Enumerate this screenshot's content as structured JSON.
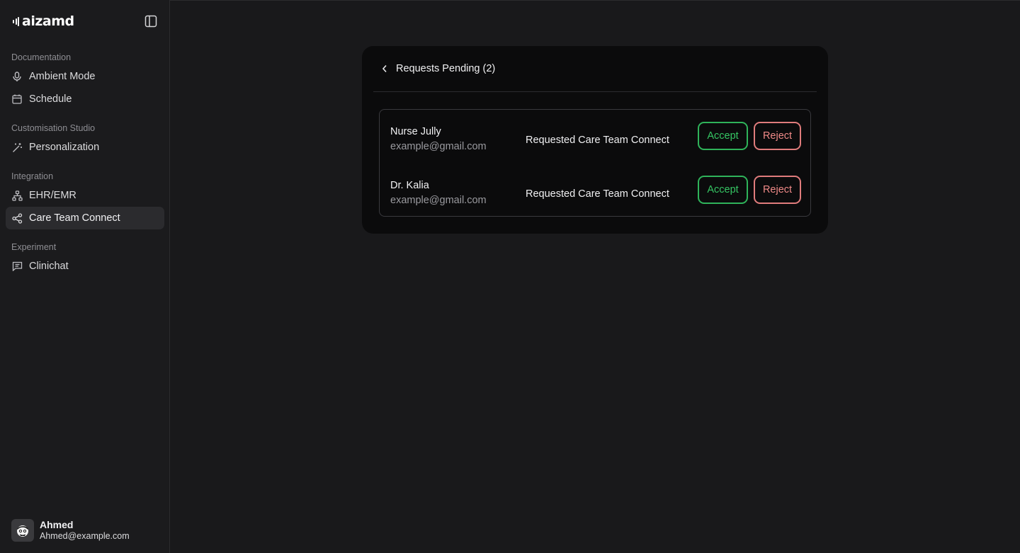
{
  "brand": {
    "name": "aizamd"
  },
  "sidebar": {
    "groups": [
      {
        "label": "Documentation",
        "items": [
          {
            "label": "Ambient Mode",
            "icon": "microphone-icon"
          },
          {
            "label": "Schedule",
            "icon": "calendar-icon"
          }
        ]
      },
      {
        "label": "Customisation Studio",
        "items": [
          {
            "label": "Personalization",
            "icon": "magic-wand-icon"
          }
        ]
      },
      {
        "label": "Integration",
        "items": [
          {
            "label": "EHR/EMR",
            "icon": "network-icon"
          },
          {
            "label": "Care Team Connect",
            "icon": "share-icon",
            "active": true
          }
        ]
      },
      {
        "label": "Experiment",
        "items": [
          {
            "label": "Clinichat",
            "icon": "chat-icon"
          }
        ]
      }
    ]
  },
  "user": {
    "name": "Ahmed",
    "email": "Ahmed@example.com"
  },
  "panel": {
    "title": "Requests Pending (2)",
    "requests": [
      {
        "name": "Nurse Jully",
        "email": "example@gmail.com",
        "status": "Requested Care Team Connect",
        "accept_label": "Accept",
        "reject_label": "Reject"
      },
      {
        "name": "Dr. Kalia",
        "email": "example@gmail.com",
        "status": "Requested Care Team Connect",
        "accept_label": "Accept",
        "reject_label": "Reject"
      }
    ]
  },
  "colors": {
    "background": "#19191b",
    "panel": "#0b0b0c",
    "accept": "#35c563",
    "reject": "#f08a88",
    "active_nav": "#2b2b2e"
  }
}
